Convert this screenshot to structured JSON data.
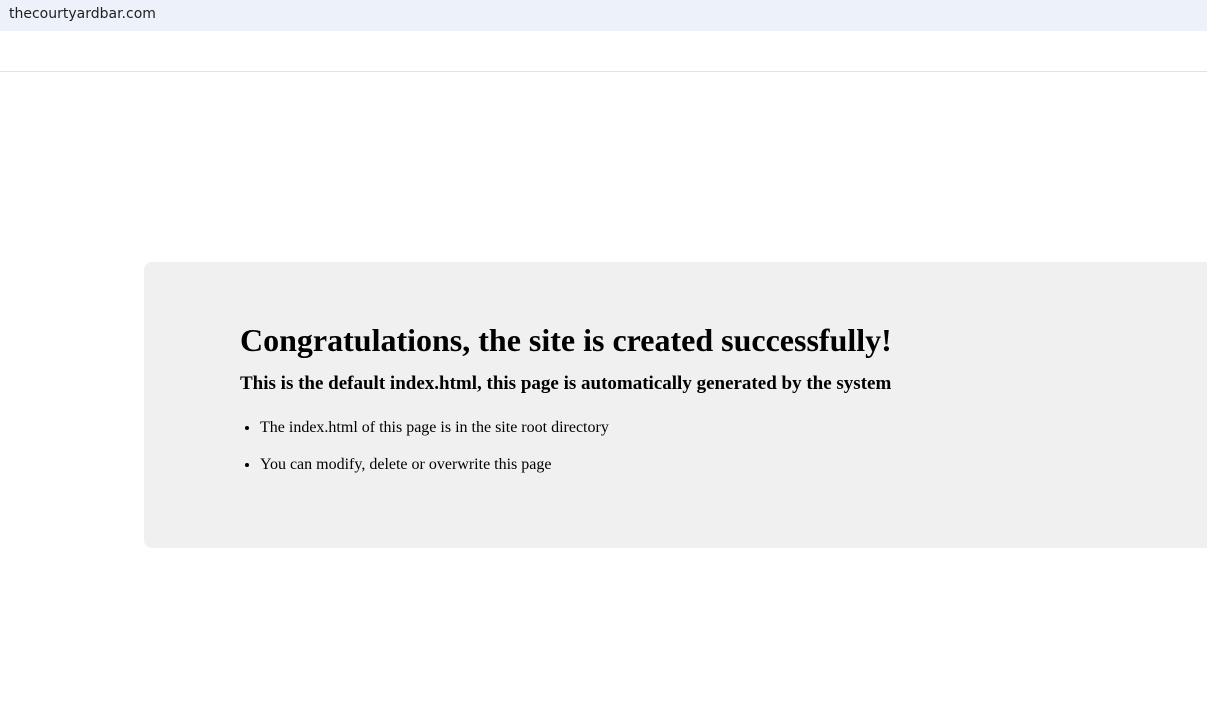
{
  "browser": {
    "url": "thecourtyardbar.com"
  },
  "page": {
    "heading": "Congratulations, the site is created successfully!",
    "subheading": "This is the default index.html, this page is automatically generated by the system",
    "items": [
      "The index.html of this page is in the site root directory",
      "You can modify, delete or overwrite this page"
    ]
  },
  "colors": {
    "url_bar_background": "#edf1f9",
    "card_background": "#f0f0f0",
    "text": "#000000"
  }
}
